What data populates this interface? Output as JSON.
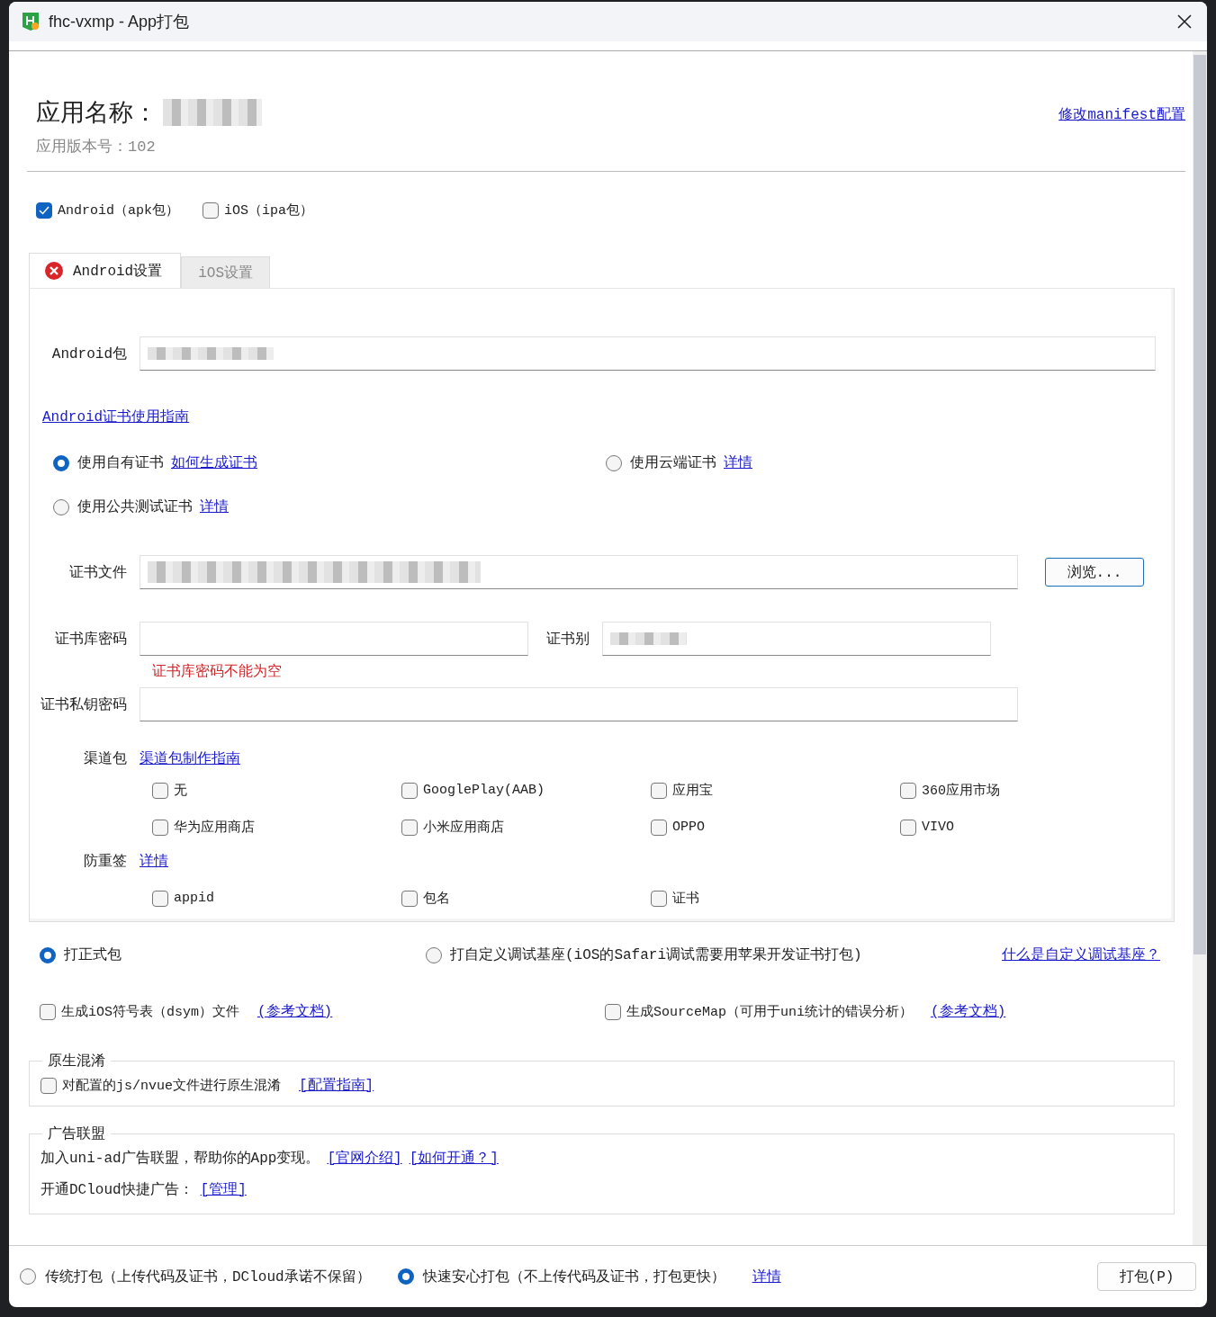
{
  "window": {
    "title": "fhc-vxmp - App打包"
  },
  "app_name_label": "应用名称：",
  "version": "应用版本号：102",
  "manifest_link": "修改manifest配置",
  "platforms": [
    {
      "label": "Android（apk包）",
      "checked": true
    },
    {
      "label": "iOS（ipa包）",
      "checked": false
    }
  ],
  "tabs": [
    {
      "label": "Android设置",
      "selected": true,
      "error": true
    },
    {
      "label": "iOS设置",
      "selected": false,
      "error": false
    }
  ],
  "android": {
    "package_label": "Android包",
    "cert_guide_link": "Android证书使用指南",
    "cert_options": [
      {
        "label": "使用自有证书",
        "link": "如何生成证书",
        "selected": true
      },
      {
        "label": "使用云端证书",
        "link": "详情",
        "selected": false
      },
      {
        "label": "使用公共测试证书",
        "link": "详情",
        "selected": false
      }
    ],
    "cert_file": {
      "label": "证书文件",
      "button": "浏览..."
    },
    "keystore_password": {
      "label": "证书库密码",
      "error": "证书库密码不能为空"
    },
    "alias": {
      "label": "证书别"
    },
    "key_password": {
      "label": "证书私钥密码"
    },
    "channels": {
      "label": "渠道包",
      "link": "渠道包制作指南",
      "items": [
        {
          "label": "无",
          "checked": false
        },
        {
          "label": "GooglePlay(AAB)",
          "checked": false
        },
        {
          "label": "应用宝",
          "checked": false
        },
        {
          "label": "360应用市场",
          "checked": false
        },
        {
          "label": "华为应用商店",
          "checked": false
        },
        {
          "label": "小米应用商店",
          "checked": false
        },
        {
          "label": "OPPO",
          "checked": false
        },
        {
          "label": "VIVO",
          "checked": false
        }
      ]
    },
    "anti_resign": {
      "label": "防重签",
      "link": "详情",
      "items": [
        {
          "label": "appid",
          "checked": false
        },
        {
          "label": "包名",
          "checked": false
        },
        {
          "label": "证书",
          "checked": false
        }
      ]
    }
  },
  "build_types": [
    {
      "label": "打正式包",
      "selected": true
    },
    {
      "label": "打自定义调试基座(iOS的Safari调试需要用苹果开发证书打包)",
      "selected": false
    }
  ],
  "build_type_help": "什么是自定义调试基座？",
  "extra_options": [
    {
      "label": "生成iOS符号表（dsym）文件",
      "link": "(参考文档)",
      "checked": false
    },
    {
      "label": "生成SourceMap（可用于uni统计的错误分析）",
      "link": "(参考文档)",
      "checked": false
    }
  ],
  "obfuscation": {
    "legend": "原生混淆",
    "label": "对配置的js/nvue文件进行原生混淆",
    "link": "[配置指南]",
    "checked": false
  },
  "ad_alliance": {
    "legend": "广告联盟",
    "text": "加入uni-ad广告联盟，帮助你的App变现。",
    "links": [
      "[官网介绍]",
      "[如何开通？]"
    ],
    "line2": "开通DCloud快捷广告：",
    "line2_link": "[管理]"
  },
  "pack_modes": [
    {
      "label": "传统打包（上传代码及证书，DCloud承诺不保留）",
      "selected": false
    },
    {
      "label": "快速安心打包（不上传代码及证书，打包更快）",
      "selected": true
    }
  ],
  "pack_mode_link": "详情",
  "pack_button": "打包(P)"
}
